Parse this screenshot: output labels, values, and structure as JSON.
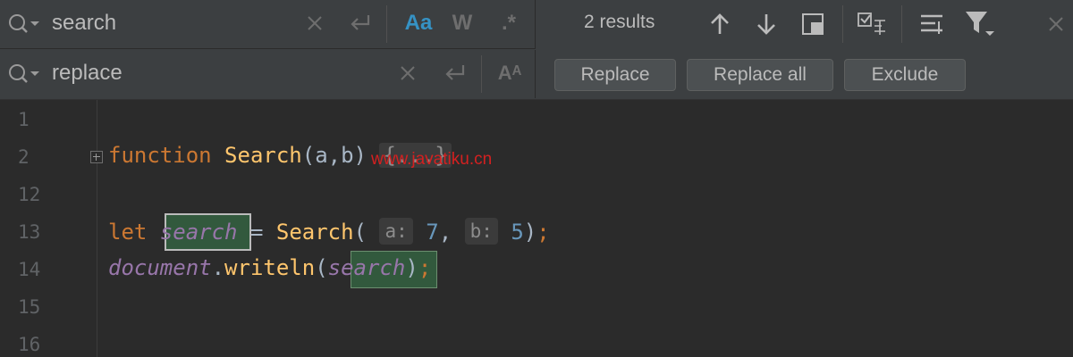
{
  "find": {
    "search_value": "search",
    "replace_value": "replace",
    "match_case_label": "Aa",
    "words_label": "W",
    "regex_label": ".*",
    "preserve_case_label": "Aᴬ",
    "results_text": "2 results"
  },
  "buttons": {
    "replace": "Replace",
    "replace_all": "Replace all",
    "exclude": "Exclude"
  },
  "editor": {
    "line_numbers": [
      "1",
      "2",
      "12",
      "13",
      "14",
      "15",
      "16"
    ],
    "fn_keyword": "function",
    "fn_name": "Search",
    "fn_params": "(a,b)",
    "fold_placeholder": "{...}",
    "let_keyword": "let",
    "var_name": "search",
    "call_name": "Search",
    "hint_a": "a:",
    "arg_a": "7",
    "hint_b": "b:",
    "arg_b": "5",
    "doc_obj": "document",
    "method": "writeln",
    "arg_var": "search"
  },
  "watermark": "www.javatiku.cn",
  "colors": {
    "panel_bg": "#3c3f41",
    "editor_bg": "#2b2b2b",
    "keyword": "#cc7832",
    "function": "#ffc66d",
    "number": "#6897bb",
    "field": "#9876aa",
    "match_bg": "#32593d",
    "active_option": "#3592c4"
  }
}
